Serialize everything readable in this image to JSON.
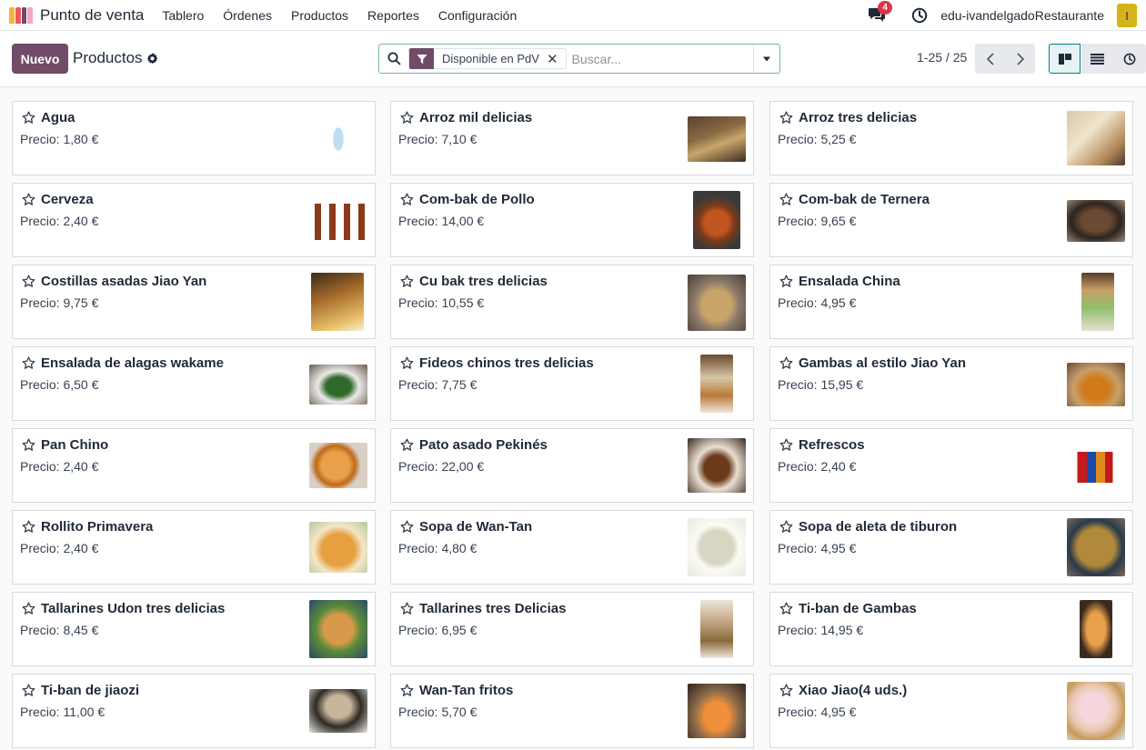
{
  "navbar": {
    "app_name": "Punto de venta",
    "menus": [
      "Tablero",
      "Órdenes",
      "Productos",
      "Reportes",
      "Configuración"
    ],
    "messages_count": "4",
    "company": "edu-ivandelgadoRestaurante",
    "avatar_letter": "I",
    "logo_colors": [
      "#f9b23c",
      "#e85c5c",
      "#714b67",
      "#f4a7c1"
    ]
  },
  "control": {
    "new_label": "Nuevo",
    "title": "Productos",
    "facet_value": "Disponible en PdV",
    "search_placeholder": "Buscar...",
    "pager": "1-25 / 25"
  },
  "price_prefix": "Precio: ",
  "products": [
    {
      "name": "Agua",
      "price": "1,80 €",
      "image": "water-bottle"
    },
    {
      "name": "Arroz mil delicias",
      "price": "7,10 €",
      "image": "fried-rice"
    },
    {
      "name": "Arroz tres delicias",
      "price": "5,25 €",
      "image": "rice-dish"
    },
    {
      "name": "Cerveza",
      "price": "2,40 €",
      "image": "beer-bottles"
    },
    {
      "name": "Com-bak de Pollo",
      "price": "14,00 €",
      "image": "chicken-dish"
    },
    {
      "name": "Com-bak de Ternera",
      "price": "9,65 €",
      "image": "beef-dish"
    },
    {
      "name": "Costillas asadas Jiao Yan",
      "price": "9,75 €",
      "image": "ribs-dish"
    },
    {
      "name": "Cu bak tres delicias",
      "price": "10,55 €",
      "image": "noodle-dish"
    },
    {
      "name": "Ensalada China",
      "price": "4,95 €",
      "image": "salad"
    },
    {
      "name": "Ensalada de alagas wakame",
      "price": "6,50 €",
      "image": "seaweed-salad"
    },
    {
      "name": "Fideos chinos tres delicias",
      "price": "7,75 €",
      "image": "noodles"
    },
    {
      "name": "Gambas al estilo Jiao Yan",
      "price": "15,95 €",
      "image": "prawns"
    },
    {
      "name": "Pan Chino",
      "price": "2,40 €",
      "image": "bread"
    },
    {
      "name": "Pato asado Pekinés",
      "price": "22,00 €",
      "image": "roast-duck"
    },
    {
      "name": "Refrescos",
      "price": "2,40 €",
      "image": "soda-cans"
    },
    {
      "name": "Rollito Primavera",
      "price": "2,40 €",
      "image": "spring-rolls"
    },
    {
      "name": "Sopa de Wan-Tan",
      "price": "4,80 €",
      "image": "wonton-soup"
    },
    {
      "name": "Sopa de aleta de tiburon",
      "price": "4,95 €",
      "image": "shark-fin-soup"
    },
    {
      "name": "Tallarines Udon tres delicias",
      "price": "8,45 €",
      "image": "udon-noodles"
    },
    {
      "name": "Tallarines tres Delicias",
      "price": "6,95 €",
      "image": "noodle-plate"
    },
    {
      "name": "Ti-ban de Gambas",
      "price": "14,95 €",
      "image": "prawn-teppan"
    },
    {
      "name": "Ti-ban de jiaozi",
      "price": "11,00 €",
      "image": "dumplings-plate"
    },
    {
      "name": "Wan-Tan fritos",
      "price": "5,70 €",
      "image": "fried-wonton"
    },
    {
      "name": "Xiao Jiao(4 uds.)",
      "price": "4,95 €",
      "image": "steamed-dumplings"
    }
  ],
  "colors": {
    "primary": "#714b67",
    "accent": "#017e84",
    "badge": "#dc3545"
  }
}
